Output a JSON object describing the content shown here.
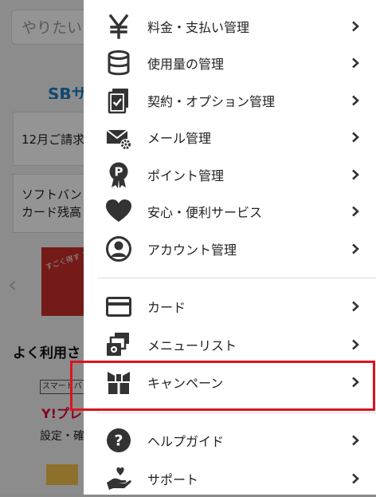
{
  "background": {
    "search_placeholder": "やりたい",
    "brand_partial": "SBサ",
    "card1_text": "12月ご請求",
    "card2_line1": "ソフトバン",
    "card2_line2": "カード残高",
    "banner_text": "すごく得す スマホ送",
    "section_title": "よく利用さ",
    "logo1_text": "スマートバ",
    "logo2_text": "Y!プレ",
    "settings_text": "設定・確"
  },
  "menu": {
    "items": [
      {
        "label": "料金・支払い管理",
        "icon": "yen-icon"
      },
      {
        "label": "使用量の管理",
        "icon": "database-icon"
      },
      {
        "label": "契約・オプション管理",
        "icon": "contract-check-icon"
      },
      {
        "label": "メール管理",
        "icon": "mail-settings-icon"
      },
      {
        "label": "ポイント管理",
        "icon": "point-badge-icon"
      },
      {
        "label": "安心・便利サービス",
        "icon": "heart-icon"
      },
      {
        "label": "アカウント管理",
        "icon": "account-icon"
      },
      {
        "label": "カード",
        "icon": "card-icon"
      },
      {
        "label": "メニューリスト",
        "icon": "menu-list-icon"
      },
      {
        "label": "キャンペーン",
        "icon": "gift-icon"
      },
      {
        "label": "ヘルプガイド",
        "icon": "help-icon"
      },
      {
        "label": "サポート",
        "icon": "support-icon"
      }
    ]
  },
  "colors": {
    "highlight": "#d9151f",
    "icon": "#333333",
    "text": "#222222",
    "chevron": "#333333"
  }
}
